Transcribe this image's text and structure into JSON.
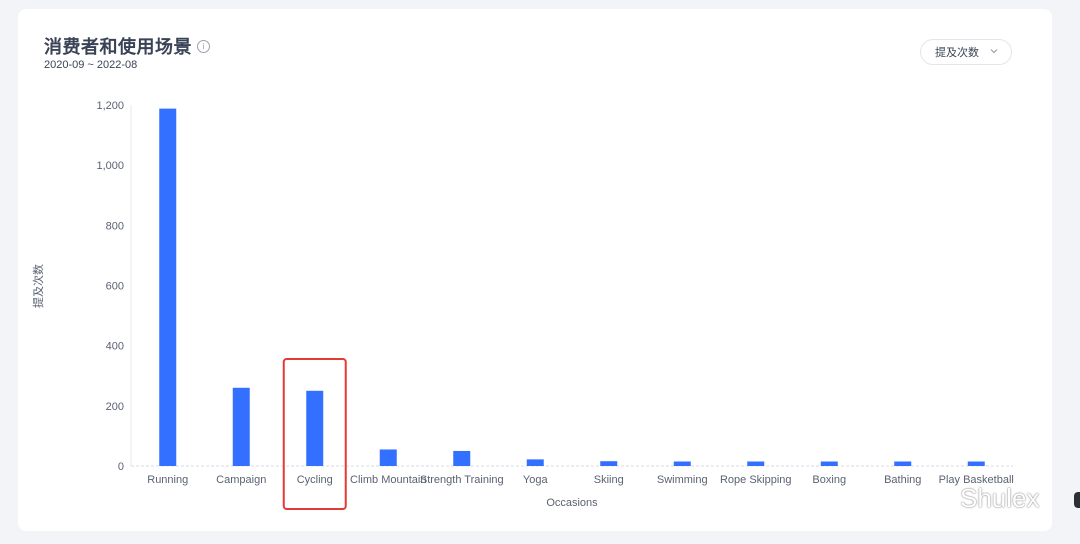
{
  "header": {
    "title": "消费者和使用场景",
    "date_range": "2020-09 ~ 2022-08",
    "dropdown_label": "提及次数"
  },
  "watermark": {
    "text": "Shulex"
  },
  "colors": {
    "bar": "#3370ff",
    "highlight": "#e53935",
    "text": "#3a4356"
  },
  "chart_data": {
    "type": "bar",
    "categories": [
      "Running",
      "Campaign",
      "Cycling",
      "Climb Mountain",
      "Strength Training",
      "Yoga",
      "Skiing",
      "Swimming",
      "Rope Skipping",
      "Boxing",
      "Bathing",
      "Play Basketball"
    ],
    "values": [
      1188,
      260,
      250,
      55,
      50,
      22,
      16,
      15,
      15,
      15,
      15,
      15
    ],
    "xlabel": "Occasions",
    "ylabel": "提及次数",
    "ylim": [
      0,
      1200
    ],
    "yticks": [
      0,
      200,
      400,
      600,
      800,
      1000,
      1200
    ],
    "ytick_labels": [
      "0",
      "200",
      "400",
      "600",
      "800",
      "1,000",
      "1,200"
    ],
    "highlighted_category": "Cycling",
    "grid": false,
    "legend": "none"
  }
}
